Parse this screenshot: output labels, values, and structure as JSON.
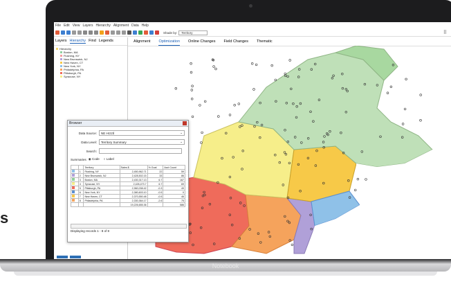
{
  "side_text": "s",
  "laptop_label": "Notebook",
  "menu": [
    "File",
    "Edit",
    "View",
    "Layers",
    "Hierarchy",
    "Alignment",
    "Data",
    "Help"
  ],
  "toolbar": {
    "shade_by_label": "Shade by:",
    "shade_by_value": "Territory"
  },
  "left_tabs": [
    "Layers",
    "Hierarchy",
    "Find",
    "Legends"
  ],
  "active_left_tab": "Hierarchy",
  "tree": [
    {
      "label": "Hierarchy",
      "color": "#f5d76e"
    },
    {
      "label": "Boston, MA",
      "color": "#8fd19e"
    },
    {
      "label": "Flushing, NY",
      "color": "#f3a0a0"
    },
    {
      "label": "New Brunswick, NJ",
      "color": "#b0a0d8"
    },
    {
      "label": "New Haven, CT",
      "color": "#f7c948"
    },
    {
      "label": "New York, NY",
      "color": "#8fc1e8"
    },
    {
      "label": "Philadelphia, PA",
      "color": "#f5a35c"
    },
    {
      "label": "Pittsburgh, PA",
      "color": "#ef6b5b"
    },
    {
      "label": "Syracuse, NY",
      "color": "#f6ee8a"
    }
  ],
  "map_tabs": [
    "Alignment",
    "Optimization",
    "Online Changes",
    "Field Changes",
    "Thematic"
  ],
  "active_map_tab": "Optimization",
  "browser": {
    "title": "Browser",
    "data_source_label": "Data Source:",
    "data_source_value": "NE Hrzztl",
    "data_level_label": "Data Level:",
    "data_level_value": "Territory Summary",
    "search_label": "Search:",
    "summaries_label": "Summaries",
    "opt_code": "Code",
    "opt_label": "Label",
    "columns": [
      "",
      "",
      "Territory",
      "Sales $",
      "% Goal",
      "Acct Count"
    ],
    "rows": [
      {
        "color": "#8fc1e8",
        "n": "1",
        "territory": "Flushing, NY",
        "sales": "2,450,962.71",
        "goal": "22",
        "count": "59"
      },
      {
        "color": "#b0a0d8",
        "n": "2",
        "territory": "New Brunswick, NJ",
        "sales": "2,428,502.15",
        "goal": "33",
        "count": "86"
      },
      {
        "color": "#8fd19e",
        "n": "3",
        "territory": "Boston, MA",
        "sales": "2,430,317.13",
        "goal": "6.7",
        "count": "167"
      },
      {
        "color": "#f6ee8a",
        "n": "4",
        "territory": "Syracuse, NY",
        "sales": "2,426,473.7",
        "goal": "6.7",
        "count": "69"
      },
      {
        "color": "#ef6b5b",
        "n": "5",
        "territory": "Pittsburgh, PA",
        "sales": "2,960,038.42",
        "goal": "-0.3",
        "count": "49"
      },
      {
        "color": "#5b8fd0",
        "n": "6",
        "territory": "New York, NY",
        "sales": "2,380,603.10",
        "goal": "-0.5",
        "count": "0"
      },
      {
        "color": "#f7c948",
        "n": "7",
        "territory": "New Haven, CT",
        "sales": "2,370,550.48",
        "goal": "-0.5",
        "count": "46"
      },
      {
        "color": "#f5a35c",
        "n": "8",
        "territory": "Philadelphia, PA",
        "sales": "2,330,364.17",
        "goal": "-2.6",
        "count": "75"
      }
    ],
    "total": "19,226,655.36",
    "total_count": "586",
    "footer": "Displaying records 1 - 8 of 8"
  }
}
